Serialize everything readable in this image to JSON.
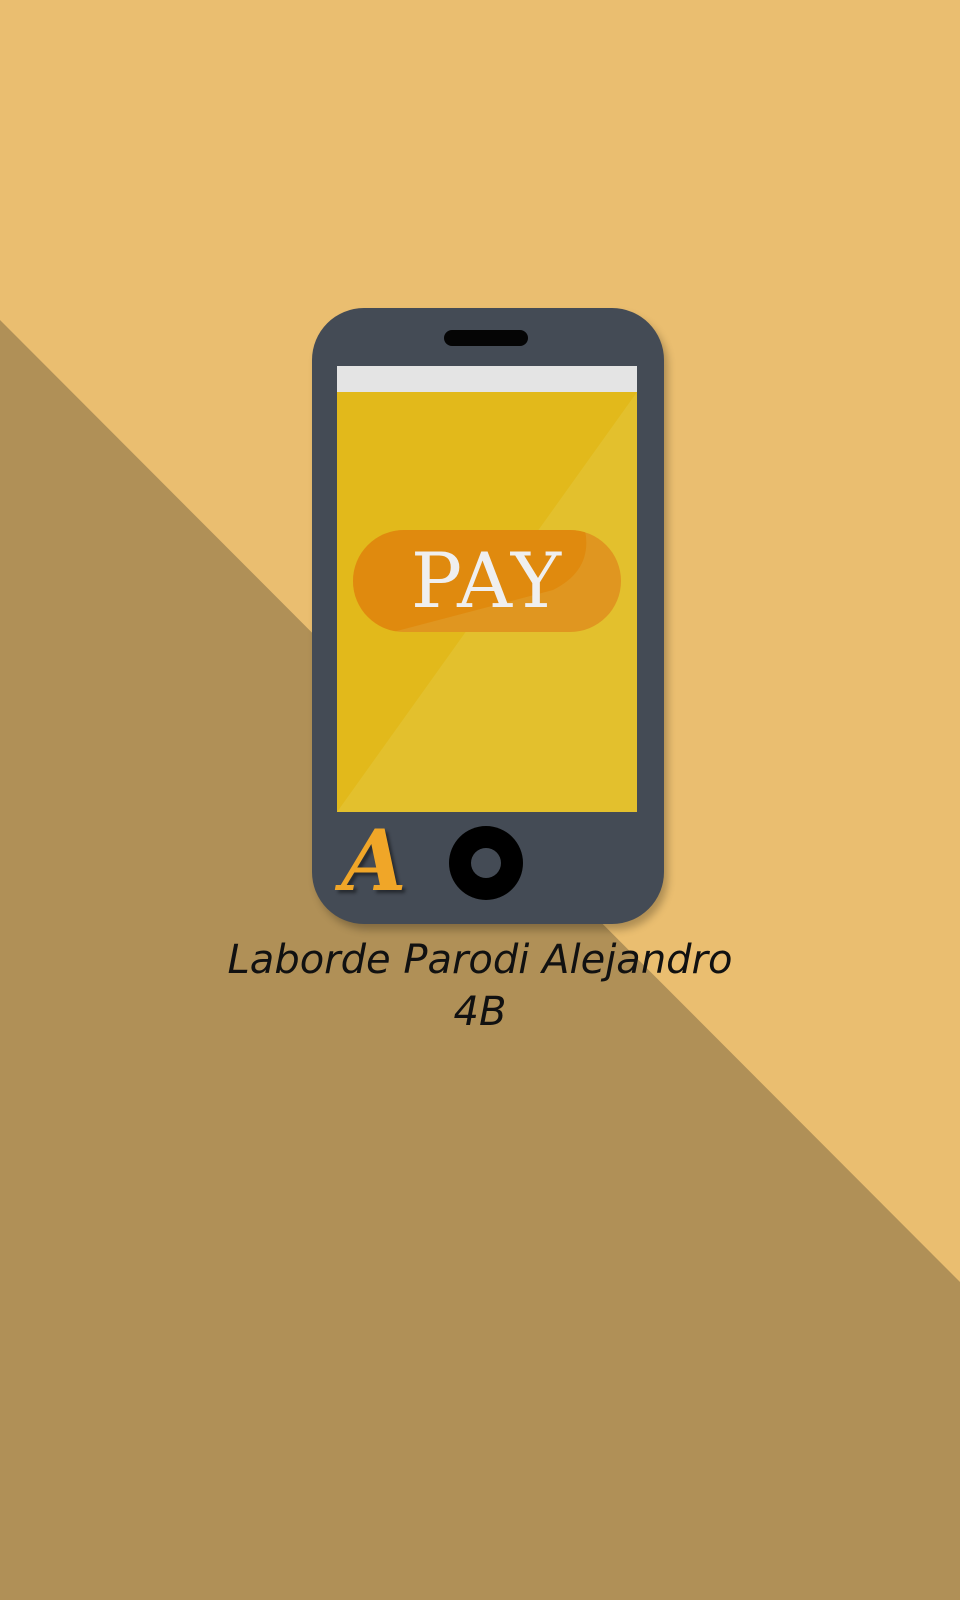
{
  "colors": {
    "background_light": "#eabe70",
    "background_dark": "#b09057",
    "phone_body": "#444b55",
    "screen": "#e2b91b",
    "pay_button": "#e09620",
    "logo": "#f0a628"
  },
  "screen": {
    "pay_label": "PAY"
  },
  "phone": {
    "logo_letter": "A"
  },
  "caption": {
    "name": "Laborde Parodi Alejandro",
    "group": "4B"
  }
}
